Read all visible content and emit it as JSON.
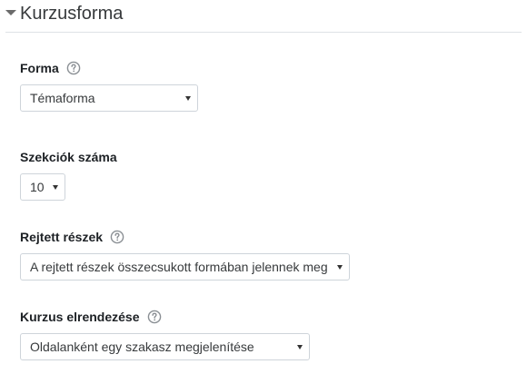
{
  "section": {
    "title": "Kurzusforma"
  },
  "fields": {
    "format": {
      "label": "Forma",
      "value": "Témaforma"
    },
    "sections_count": {
      "label": "Szekciók száma",
      "value": "10"
    },
    "hidden_sections": {
      "label": "Rejtett részek",
      "value": "A rejtett részek összecsukott formában jelennek meg"
    },
    "course_layout": {
      "label": "Kurzus elrendezése",
      "value": "Oldalanként egy szakasz megjelenítése"
    }
  },
  "icons": {
    "collapse": "chevron-down-icon",
    "help": "question-circle-icon"
  },
  "colors": {
    "help_icon": "#8a8f94",
    "divider": "#dee2e6",
    "select_border": "#ced4da"
  }
}
